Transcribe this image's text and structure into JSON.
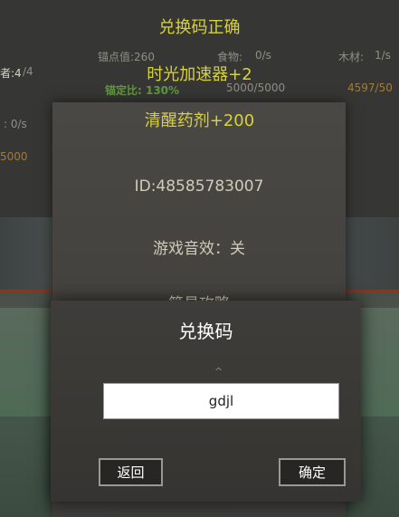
{
  "resources": {
    "anchor_value": "锚点值:260",
    "food_label": "食物:",
    "food_rate": "0/s",
    "wood_label": "木材:",
    "wood_rate": "1/s",
    "left_value": "者:4",
    "left_value_denom": "/4",
    "anchor_ratio": "锚定比: 130%",
    "food_amount": "5000/5000",
    "wood_amount": "4597/50",
    "left_rate": ": 0/s",
    "left_amount": "5000"
  },
  "toasts": [
    "兑换码正确",
    "时光加速器+2",
    "清醒药剂+200"
  ],
  "settings": {
    "player_id": "ID:48585783007",
    "sound": "游戏音效：关",
    "guide": "简易攻略"
  },
  "dialog": {
    "title": "兑换码",
    "caret": "^",
    "input_value": "gdjl",
    "back_label": "返回",
    "confirm_label": "确定"
  }
}
